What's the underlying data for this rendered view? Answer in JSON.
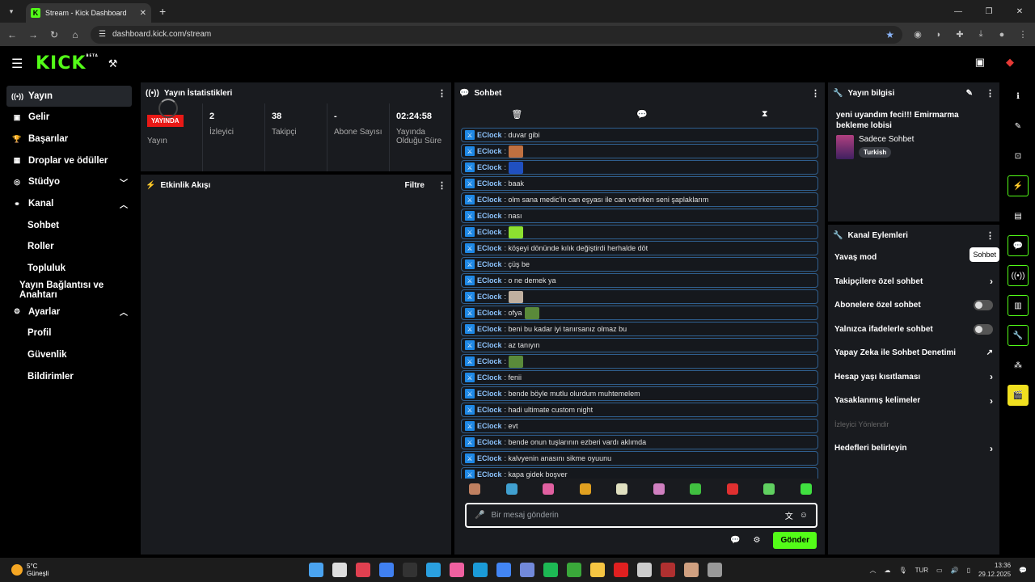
{
  "browser": {
    "tab_title": "Stream - Kick Dashboard",
    "url": "dashboard.kick.com/stream"
  },
  "nav": {
    "logo": "KICK",
    "beta": "BETA"
  },
  "sidebar": {
    "items": [
      {
        "label": "Yayın",
        "icon": "broadcast-icon"
      },
      {
        "label": "Gelir",
        "icon": "revenue-icon"
      },
      {
        "label": "Başarılar",
        "icon": "trophy-icon"
      },
      {
        "label": "Droplar ve ödüller",
        "icon": "drops-icon"
      },
      {
        "label": "Stüdyo",
        "icon": "studio-icon"
      },
      {
        "label": "Kanal",
        "icon": "channel-icon"
      },
      {
        "label": "Sohbet"
      },
      {
        "label": "Roller"
      },
      {
        "label": "Topluluk"
      },
      {
        "label": "Yayın Bağlantısı ve Anahtarı"
      },
      {
        "label": "Ayarlar",
        "icon": "settings-icon"
      },
      {
        "label": "Profil"
      },
      {
        "label": "Güvenlik"
      },
      {
        "label": "Bildirimler"
      }
    ]
  },
  "stats": {
    "title": "Yayın İstatistikleri",
    "live_badge": "YAYINDA",
    "stream_label": "Yayın",
    "viewers_value": "2",
    "viewers_label": "İzleyici",
    "followers_value": "38",
    "followers_label": "Takipçi",
    "subs_value": "-",
    "subs_label": "Abone Sayısı",
    "uptime_value": "02:24:58",
    "uptime_label": "Yayında Olduğu Süre"
  },
  "activity": {
    "title": "Etkinlik Akışı",
    "filter": "Filtre"
  },
  "chat": {
    "title": "Sohbet",
    "user": "EClock",
    "messages": [
      {
        "text": ": duvar gibi"
      },
      {
        "text": ":",
        "emote": "#c07040"
      },
      {
        "text": ":",
        "emote": "#2050c0"
      },
      {
        "text": ": baak"
      },
      {
        "text": ": olm sana medic'in can eşyası ile can verirken seni şaplaklarım"
      },
      {
        "text": ": nası"
      },
      {
        "text": ":",
        "emote": "#8de030"
      },
      {
        "text": ": köşeyi dönünde kılık değiştirdi herhalde döt"
      },
      {
        "text": ": çüş be"
      },
      {
        "text": ": o ne demek ya"
      },
      {
        "text": ":",
        "emote": "#c0b0a0"
      },
      {
        "text": ": ofya",
        "emote": "#5a8a3a"
      },
      {
        "text": ": beni bu kadar iyi tanırsanız olmaz bu"
      },
      {
        "text": ": az tanıyın"
      },
      {
        "text": ":",
        "emote": "#5a8a3a"
      },
      {
        "text": ": fenii"
      },
      {
        "text": ": bende böyle mutlu olurdum muhtemelem"
      },
      {
        "text": ": hadi ultimate custom night"
      },
      {
        "text": ": evt"
      },
      {
        "text": ": bende onun tuşlarının ezberi vardı aklımda"
      },
      {
        "text": ": kalvyenin anasını sikme oyuunu"
      },
      {
        "text": ": kapa gidek boşver"
      }
    ],
    "emote_bar": [
      "#c08060",
      "#40a0d0",
      "#e060a0",
      "#e0a020",
      "#e0e0c0",
      "#d080c0",
      "#40c040",
      "#e03030",
      "#60d060",
      "#40e040"
    ],
    "input_placeholder": "Bir mesaj gönderin",
    "send_label": "Gönder"
  },
  "stream_info": {
    "title": "Yayın bilgisi",
    "stream_title": "yeni uyandım feci!!! Emirmarma bekleme lobisi",
    "category": "Sadece Sohbet",
    "language": "Turkish"
  },
  "channel_actions": {
    "title": "Kanal Eylemleri",
    "items": [
      {
        "label": "Yavaş mod",
        "control": "chevron"
      },
      {
        "label": "Takipçilere özel sohbet",
        "control": "chevron"
      },
      {
        "label": "Abonelere özel sohbet",
        "control": "toggle"
      },
      {
        "label": "Yalnızca ifadelerle sohbet",
        "control": "toggle"
      },
      {
        "label": "Yapay Zeka ile Sohbet Denetimi",
        "control": "external"
      },
      {
        "label": "Hesap yaşı kısıtlaması",
        "control": "chevron"
      },
      {
        "label": "Yasaklanmış kelimeler",
        "control": "chevron"
      },
      {
        "label": "İzleyici Yönlendir",
        "control": "none"
      },
      {
        "label": "Hedefleri belirleyin",
        "control": "chevron"
      }
    ]
  },
  "right_rail": {
    "tooltip": "Sohbet"
  },
  "taskbar": {
    "temp": "5°C",
    "weather": "Güneşli",
    "weather_badge": "1",
    "lang": "TUR",
    "time": "13:36",
    "date": "29.12.2025",
    "apps": [
      "#4aa3f0",
      "#dddddd",
      "#e04050",
      "#4080f0",
      "#333333",
      "#2aa0e0",
      "#f060a0",
      "#1b9bd8",
      "#4285f4",
      "#7289da",
      "#1db954",
      "#3aa83a",
      "#f5c542",
      "#e02020",
      "#cccccc",
      "#b03030",
      "#d0a080",
      "#999999"
    ]
  }
}
